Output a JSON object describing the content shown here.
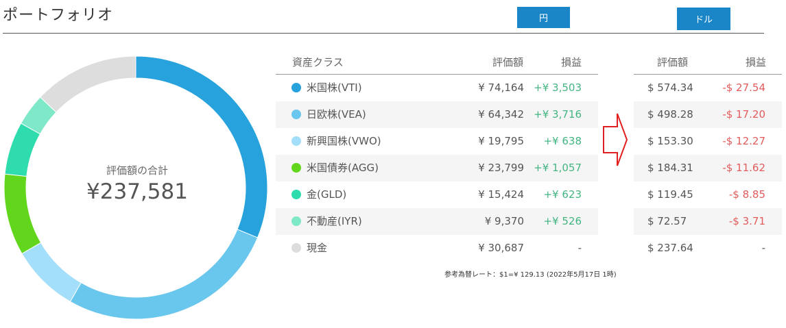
{
  "page": {
    "title": "ポートフォリオ",
    "yen_button": "円",
    "usd_button": "ドル"
  },
  "donut": {
    "label": "評価額の合計",
    "total": "¥237,581"
  },
  "table": {
    "headers": {
      "asset": "資産クラス",
      "value": "評価額",
      "pl": "損益"
    },
    "rows": [
      {
        "asset": "米国株(VTI)",
        "color": "#27a2dc",
        "value_yen": "¥ 74,164",
        "pl_yen": "+¥ 3,503",
        "value_usd": "$ 574.34",
        "pl_usd": "-$ 27.54"
      },
      {
        "asset": "日欧株(VEA)",
        "color": "#69c6ec",
        "value_yen": "¥ 64,342",
        "pl_yen": "+¥ 3,716",
        "value_usd": "$ 498.28",
        "pl_usd": "-$ 17.20"
      },
      {
        "asset": "新興国株(VWO)",
        "color": "#a3dffa",
        "value_yen": "¥ 19,795",
        "pl_yen": "+¥ 638",
        "value_usd": "$ 153.30",
        "pl_usd": "-$ 12.27"
      },
      {
        "asset": "米国債券(AGG)",
        "color": "#62d61d",
        "value_yen": "¥ 23,799",
        "pl_yen": "+¥ 1,057",
        "value_usd": "$ 184.31",
        "pl_usd": "-$ 11.62"
      },
      {
        "asset": "金(GLD)",
        "color": "#2edcae",
        "value_yen": "¥ 15,424",
        "pl_yen": "+¥ 623",
        "value_usd": "$ 119.45",
        "pl_usd": "-$ 8.85"
      },
      {
        "asset": "不動産(IYR)",
        "color": "#7ee8c8",
        "value_yen": "¥ 9,370",
        "pl_yen": "+¥ 526",
        "value_usd": "$ 72.57",
        "pl_usd": "-$ 3.71"
      },
      {
        "asset": "現金",
        "color": "#dddddd",
        "value_yen": "¥ 30,687",
        "pl_yen": "-",
        "value_usd": "$ 237.64",
        "pl_usd": "-"
      }
    ]
  },
  "note": "参考為替レート：$1=¥ 129.13 (2022年5月17日 1時)",
  "colors": {
    "button": "#1a86c7",
    "positive": "#43b581",
    "negative": "#e35b5b",
    "arrow": "#e02020"
  }
}
